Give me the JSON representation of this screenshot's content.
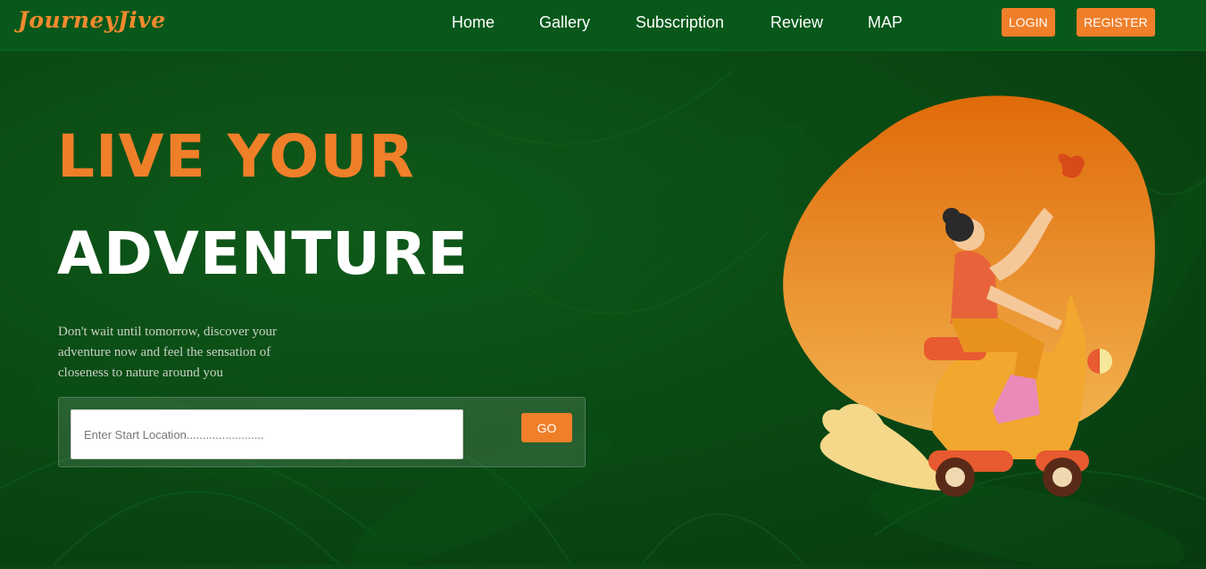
{
  "brand": {
    "name": "JourneyJive"
  },
  "nav": {
    "items": [
      "Home",
      "Gallery",
      "Subscription",
      "Review",
      "MAP"
    ],
    "login_label": "LOGIN",
    "register_label": "REGISTER"
  },
  "hero": {
    "title_line1": "LIVE YOUR",
    "title_line2": "ADVENTURE",
    "subtitle": "Don't wait until tomorrow, discover your adventure now and feel the sensation of closeness to nature around you",
    "search": {
      "placeholder": "Enter Start Location........................",
      "go_label": "GO"
    },
    "illustration": "woman-riding-scooter-icon"
  },
  "colors": {
    "accent": "#f07f2a",
    "header_bg": "#07581a",
    "background": "#0a4a14"
  }
}
